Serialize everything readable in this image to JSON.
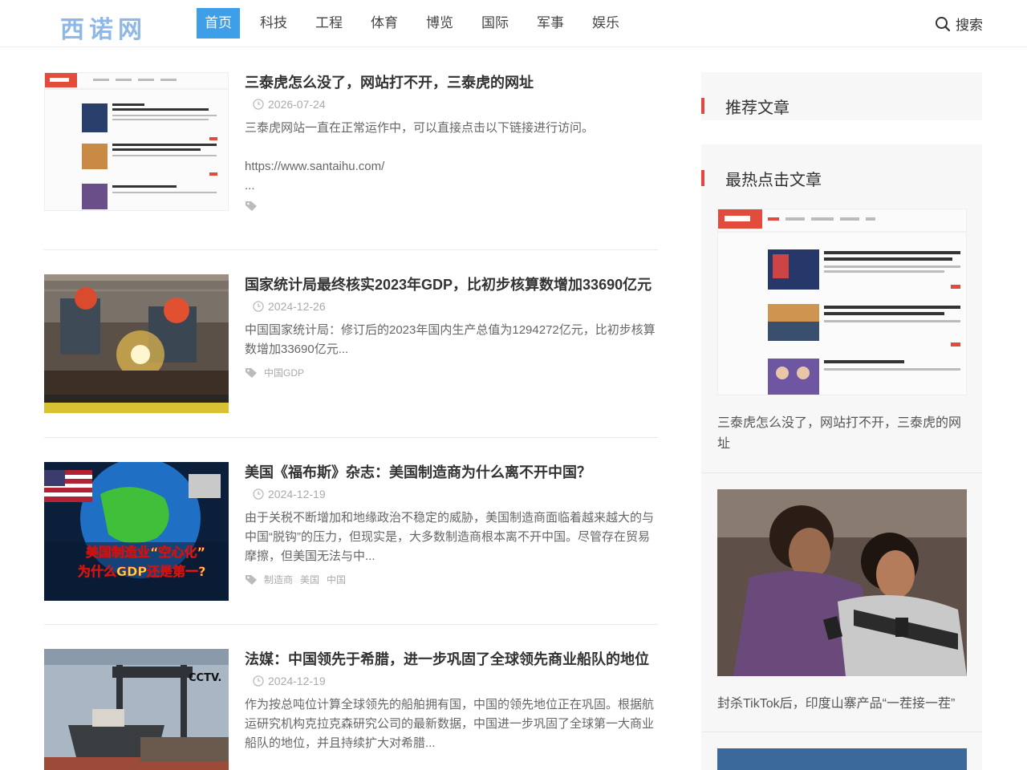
{
  "header": {
    "logo": "西诺网",
    "nav": [
      "首页",
      "科技",
      "工程",
      "体育",
      "博览",
      "国际",
      "军事",
      "娱乐"
    ],
    "search_label": "搜索"
  },
  "articles": [
    {
      "title": "三泰虎怎么没了，网站打不开，三泰虎的网址",
      "date": "2026-07-24",
      "summary": "三泰虎网站一直在正常运作中，可以直接点击以下链接进行访问。",
      "url": "https://www.santaihu.com/",
      "ellipsis": "...",
      "tags": []
    },
    {
      "title": "国家统计局最终核实2023年GDP，比初步核算数增加33690亿元",
      "date": "2024-12-26",
      "summary": "中国国家统计局：修订后的2023年国内生产总值为1294272亿元，比初步核算数增加33690亿元...",
      "tags": [
        "中国GDP"
      ]
    },
    {
      "title": "美国《福布斯》杂志：美国制造商为什么离不开中国？",
      "date": "2024-12-19",
      "summary": "由于关税不断增加和地缘政治不稳定的威胁，美国制造商面临着越来越大的与中国“脱钩”的压力，但现实是，大多数制造商根本离不开中国。尽管存在贸易摩擦，但美国无法与中...",
      "tags": [
        "制造商",
        "美国",
        "中国"
      ],
      "image_caption_line1": "美国制造业“空心化”",
      "image_caption_line2": "为什么GDP还是第一?"
    },
    {
      "title": "法媒：中国领先于希腊，进一步巩固了全球领先商业船队的地位",
      "date": "2024-12-19",
      "summary": "作为按总吨位计算全球领先的船舶拥有国，中国的领先地位正在巩固。根据航运研究机构克拉克森研究公司的最新数据，中国进一步巩固了全球第一大商业船队的地位，并且持续扩大对希腊...",
      "tags": [],
      "image_logo": "CCTV."
    }
  ],
  "sidebar": {
    "recommend_title": "推荐文章",
    "hot_title": "最热点击文章",
    "hot_items": [
      {
        "caption": "三泰虎怎么没了，网站打不开，三泰虎的网址"
      },
      {
        "caption": "封杀TikTok后，印度山寨产品“一茬接一茬”"
      }
    ]
  },
  "colors": {
    "nav_active": "#3f9ee8",
    "logo": "#8fb8e6",
    "widget_bar": "#e04848",
    "widget_bg": "#f7f7f7"
  }
}
